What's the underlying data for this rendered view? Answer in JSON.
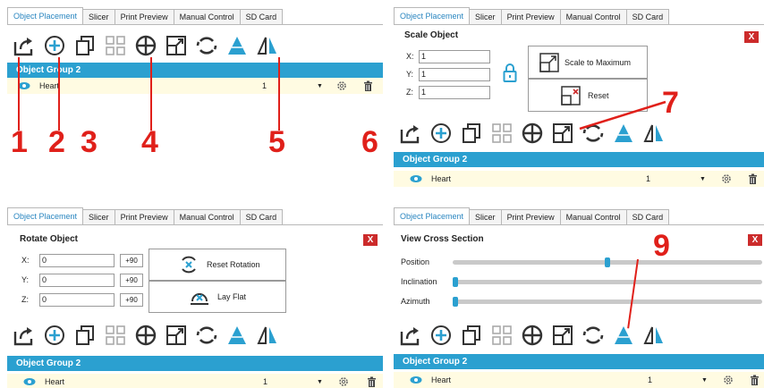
{
  "tabs": [
    "Object Placement",
    "Slicer",
    "Print Preview",
    "Manual Control",
    "SD Card"
  ],
  "group_label": "Object Group 2",
  "object": {
    "name": "Heart",
    "count": "1"
  },
  "toolbar_icons": [
    "export-icon",
    "add-icon",
    "copy-icon",
    "grid-icon",
    "position-icon",
    "scale-icon",
    "rotate-icon",
    "cross-section-icon",
    "mirror-icon"
  ],
  "accent": "#2ba0d0",
  "callout_color": "#e0201a",
  "callouts": {
    "n1": "1",
    "n2": "2",
    "n3": "3",
    "n4": "4",
    "n5": "5",
    "n6": "6",
    "n7": "7",
    "n9": "9"
  },
  "scale": {
    "title": "Scale Object",
    "x_label": "X:",
    "y_label": "Y:",
    "z_label": "Z:",
    "x": "1",
    "y": "1",
    "z": "1",
    "max_label": "Scale to Maximum",
    "reset_label": "Reset"
  },
  "rotate": {
    "title": "Rotate Object",
    "x_label": "X:",
    "y_label": "Y:",
    "z_label": "Z:",
    "x": "0",
    "y": "0",
    "z": "0",
    "step": "+90",
    "reset_label": "Reset Rotation",
    "lay_flat_label": "Lay Flat"
  },
  "cross": {
    "title": "View Cross Section",
    "position_label": "Position",
    "inclination_label": "Inclination",
    "azimuth_label": "Azimuth",
    "position_value": 0.5,
    "inclination_value": 0.0,
    "azimuth_value": 0.0
  },
  "close": "X"
}
